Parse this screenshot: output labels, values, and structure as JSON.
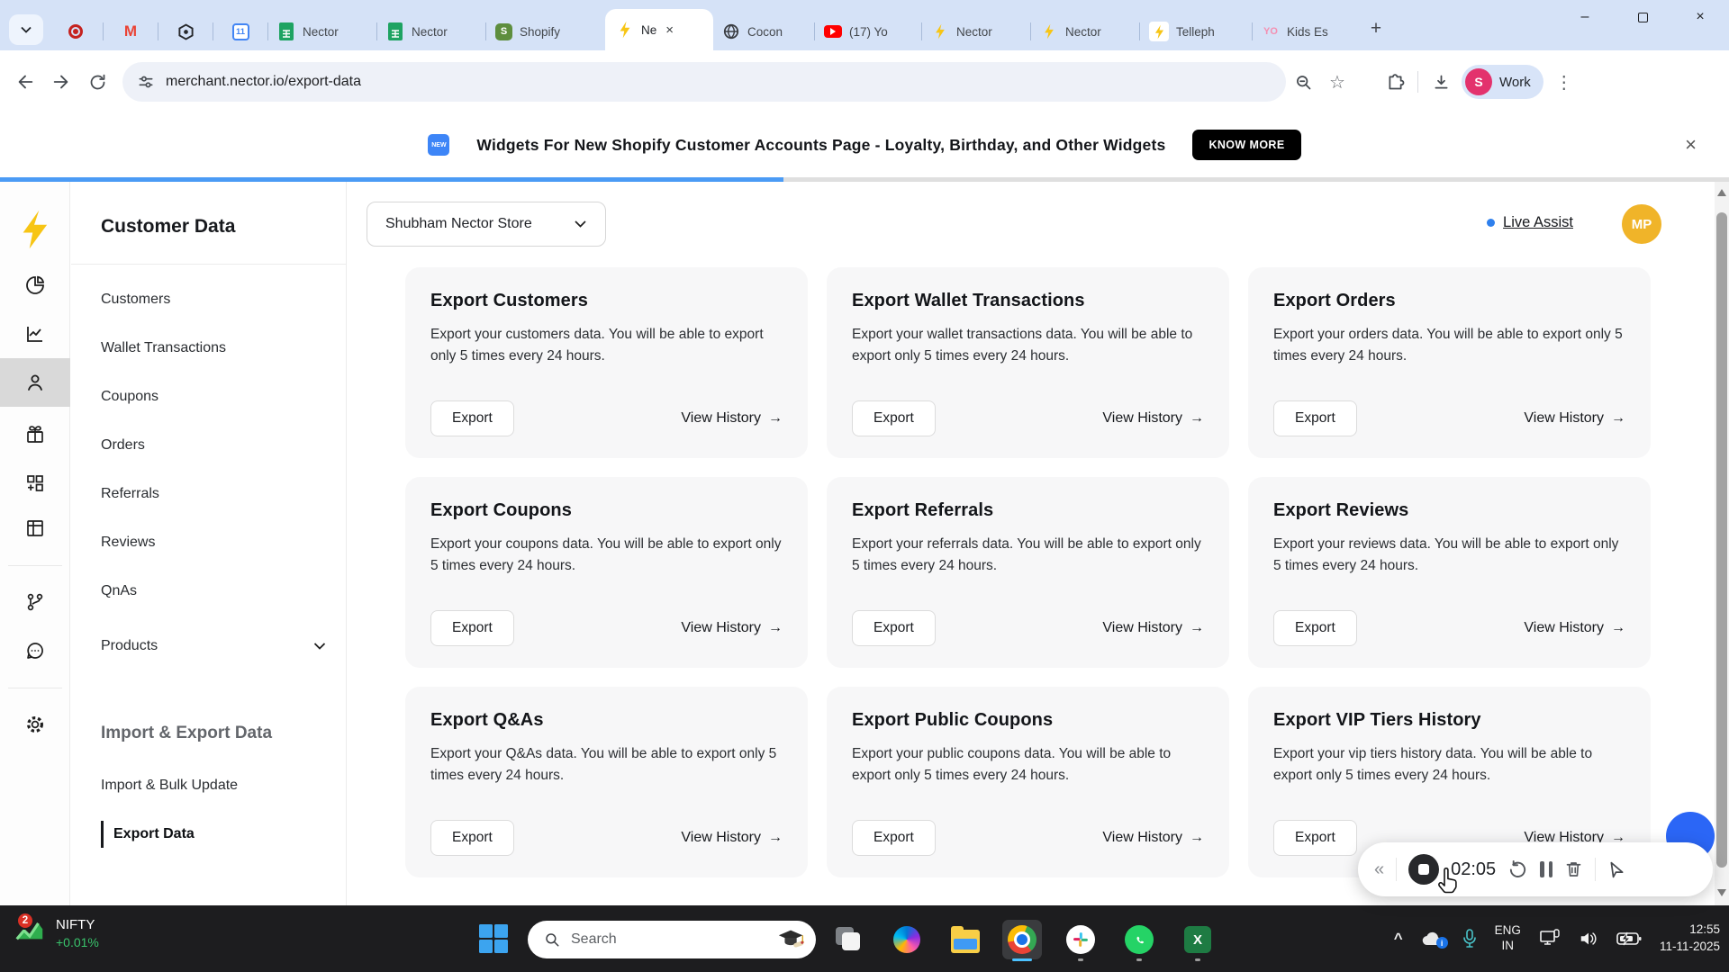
{
  "colors": {
    "accent_blue": "#4b9bf5",
    "live_assist_dot": "#2f80ed",
    "avatar_yellow": "#f0b429",
    "cta_black": "#000000",
    "positive_green": "#39c26b",
    "record_red": "#c5221f",
    "taskbar_dark": "#1d1d1f"
  },
  "browser": {
    "tabs": {
      "sheet1": "Nector",
      "sheet2": "Nector",
      "shopify": "Shopify",
      "active": "Ne",
      "coconut": "Cocon",
      "youtube": "(17) Yo",
      "nector3": "Nector",
      "nector4": "Nector",
      "telleph": "Telleph",
      "kids": "Kids Es"
    },
    "calendar_day": "11",
    "gmail_letter": "M",
    "shopify_letter": "S",
    "yo_letters": "YO",
    "url": "merchant.nector.io/export-data",
    "profile_name": "Work",
    "profile_initial": "S"
  },
  "glyphs": {
    "new_tab": "+",
    "minimize": "–",
    "close": "×",
    "kebab": "⋮",
    "star": "☆",
    "banner_close": "×",
    "collapse": "«",
    "tray_chevron": "^",
    "arrow_right": "→"
  },
  "banner": {
    "badge": "NEW",
    "text": "Widgets For New Shopify Customer Accounts Page - Loyalty, Birthday, and Other Widgets",
    "cta": "KNOW MORE"
  },
  "sidebar": {
    "title": "Customer Data",
    "items": [
      "Customers",
      "Wallet Transactions",
      "Coupons",
      "Orders",
      "Referrals",
      "Reviews",
      "QnAs",
      "Products"
    ],
    "section_title": "Import & Export Data",
    "import_items": [
      "Import & Bulk Update",
      "Export Data"
    ]
  },
  "topbar": {
    "store": "Shubham Nector Store",
    "live_assist": "Live Assist",
    "avatar": "MP"
  },
  "labels": {
    "export": "Export",
    "view_history": "View History"
  },
  "cards": [
    {
      "title": "Export Customers",
      "desc": "Export your customers data. You will be able to export only 5 times every 24 hours."
    },
    {
      "title": "Export Wallet Transactions",
      "desc": "Export your wallet transactions data. You will be able to export only 5 times every 24 hours."
    },
    {
      "title": "Export Orders",
      "desc": "Export your orders data. You will be able to export only 5 times every 24 hours."
    },
    {
      "title": "Export Coupons",
      "desc": "Export your coupons data. You will be able to export only 5 times every 24 hours."
    },
    {
      "title": "Export Referrals",
      "desc": "Export your referrals data. You will be able to export only 5 times every 24 hours."
    },
    {
      "title": "Export Reviews",
      "desc": "Export your reviews data. You will be able to export only 5 times every 24 hours."
    },
    {
      "title": "Export Q&As",
      "desc": "Export your Q&As data. You will be able to export only 5 times every 24 hours."
    },
    {
      "title": "Export Public Coupons",
      "desc": "Export your public coupons data. You will be able to export only 5 times every 24 hours."
    },
    {
      "title": "Export VIP Tiers History",
      "desc": "Export your vip tiers history data. You will be able to export only 5 times every 24 hours."
    }
  ],
  "recorder": {
    "time": "02:05"
  },
  "taskbar": {
    "widget_ticker": "NIFTY",
    "widget_change": "+0.01%",
    "widget_badge": "2",
    "search_placeholder": "Search",
    "lang_line1": "ENG",
    "lang_line2": "IN",
    "time": "12:55",
    "date": "11-11-2025"
  }
}
